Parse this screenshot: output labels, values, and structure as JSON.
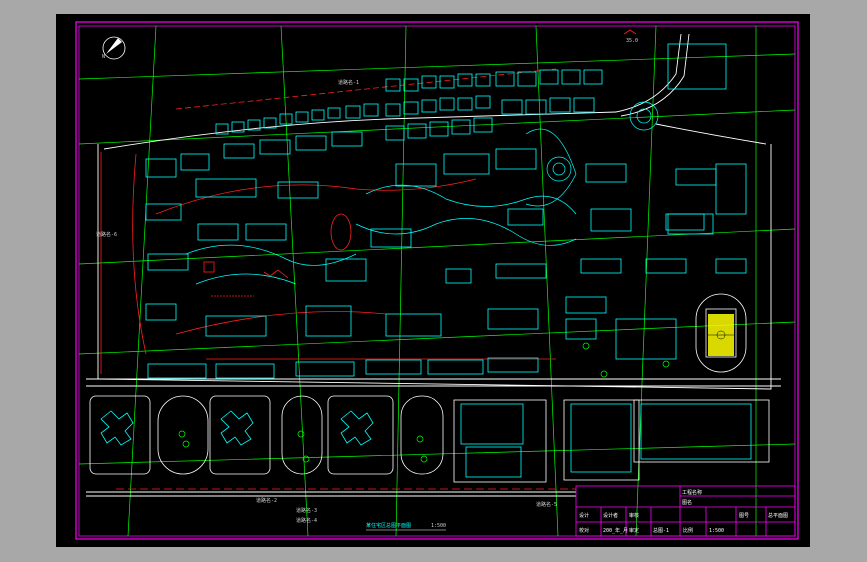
{
  "drawing": {
    "north_label": "N",
    "title": "某住宅区总图平面图",
    "scale": "1:500",
    "top_annotation": "35.0",
    "road_labels": [
      "道路名-1",
      "道路名-2",
      "道路名-3",
      "道路名-4",
      "道路名-5",
      "道路名-6"
    ],
    "colors": {
      "background": "#000000",
      "border": "#ff00ff",
      "building": "#00ffff",
      "road": "#ffffff",
      "grid": "#00ff00",
      "redline": "#ff2020",
      "annotation": "#d0d0d0"
    }
  },
  "title_block": {
    "project": "工程名称",
    "drawing_name": "图名",
    "row_labels": [
      "设计",
      "校对",
      "审核",
      "审定"
    ],
    "designer": "设计者",
    "date": "200_年_月",
    "sheet": "总图-1",
    "scale_label": "比例",
    "scale_value": "1:500",
    "drawing_no_label": "图号",
    "drawing_no": "总平面图"
  }
}
